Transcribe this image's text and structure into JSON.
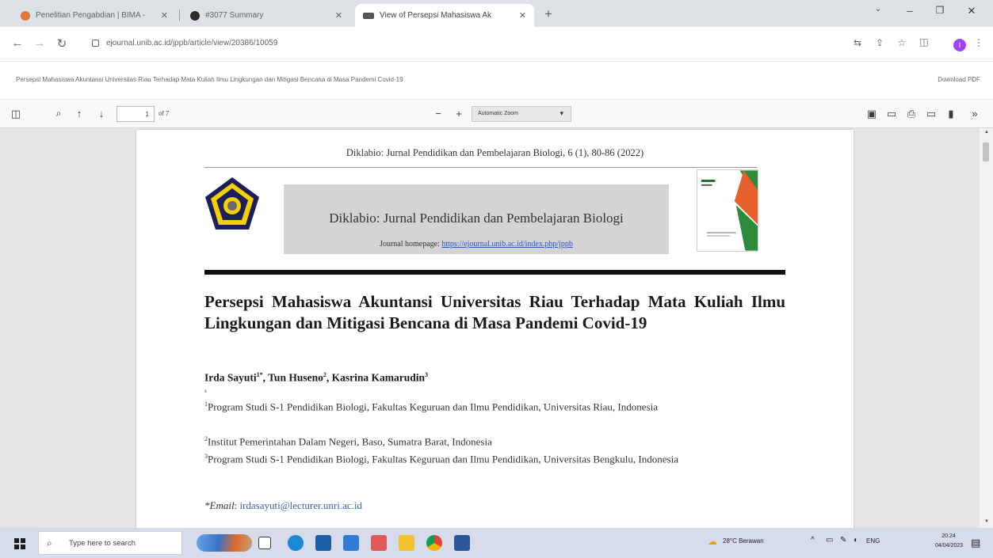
{
  "browser": {
    "tabs": [
      {
        "title": "Penelitian Pengabdian | BIMA -",
        "favicon_color": "#e0763a"
      },
      {
        "title": "#3077 Summary",
        "favicon_color": "#2b2b2b"
      },
      {
        "title": "View of Persepsi Mahasiswa Ak",
        "favicon_color": "#555555",
        "active": true
      }
    ],
    "url": "ejournal.unib.ac.id/jppb/article/view/20386/10059",
    "profile_initial": "I"
  },
  "page": {
    "title": "Persepsi Mahasiswa Akuntansi Universitas Riau Terhadap Mata Kuliah Ilmu Lingkungan dan Mitigasi Bencana di Masa Pandemi Covid-19",
    "download_label": "Download PDF"
  },
  "pdf_viewer": {
    "page_number": "1",
    "page_count": "of 7",
    "zoom": "Automatic Zoom"
  },
  "document": {
    "running_head": "Diklabio: Jurnal Pendidikan dan Pembelajaran Biologi, 6 (1), 80-86 (2022)",
    "journal_name": "Diklabio: Jurnal Pendidikan dan Pembelajaran Biologi",
    "homepage_label": "Journal homepage:",
    "homepage_link": "https://ejournal.unib.ac.id/index.php/jppb",
    "paper_title": "Persepsi Mahasiswa Akuntansi Universitas Riau Terhadap Mata Kuliah Ilmu Lingkungan dan Mitigasi Bencana di Masa Pandemi Covid-19",
    "authors": [
      {
        "name": "Irda Sayuti",
        "mark": "1*"
      },
      {
        "name": "Tun Huseno",
        "mark": "2"
      },
      {
        "name": "Kasrina Kamarudin",
        "mark": "3"
      }
    ],
    "small_mark": "s",
    "affiliations": [
      {
        "mark": "1",
        "text": "Program Studi S-1 Pendidikan Biologi, Fakultas Keguruan dan Ilmu Pendidikan, Universitas Riau, Indonesia"
      },
      {
        "mark": "2",
        "text": "Institut Pemerintahan Dalam Negeri, Baso, Sumatra Barat, Indonesia"
      },
      {
        "mark": "3",
        "text": "Program Studi S-1 Pendidikan Biologi, Fakultas Keguruan dan Ilmu Pendidikan, Universitas Bengkulu, Indonesia"
      }
    ],
    "email_label": "*Email",
    "email": "irdasayuti@lecturer.unri.ac.id"
  },
  "taskbar": {
    "search_placeholder": "Type here to search",
    "weather": "28°C  Berawan",
    "language": "ENG",
    "time": "20:24",
    "date": "04/04/2023"
  },
  "colors": {
    "link": "#2a55c9",
    "taskbar": "#d6dcec",
    "tabstrip": "#dee1e6"
  }
}
